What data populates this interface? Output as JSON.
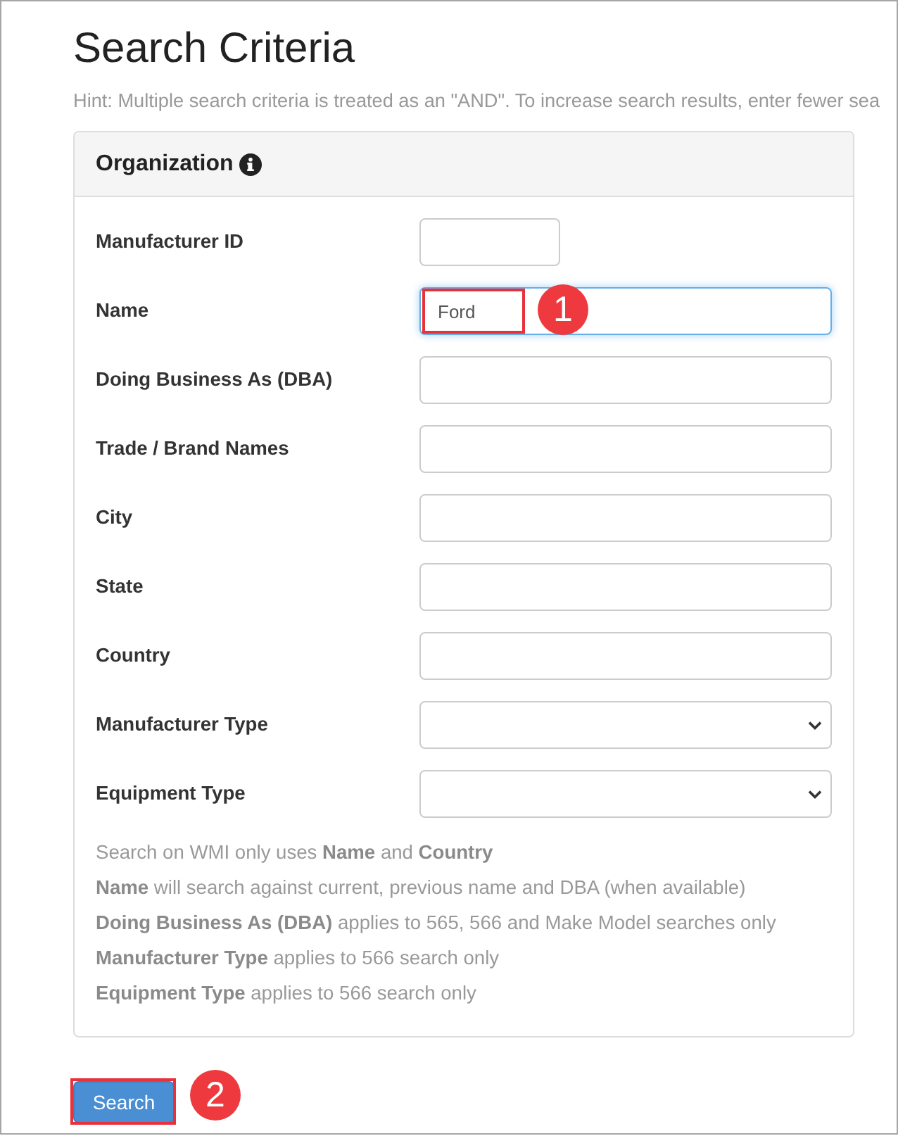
{
  "page": {
    "title": "Search Criteria",
    "hint": "Hint: Multiple search criteria is treated as an \"AND\". To increase search results, enter fewer sea"
  },
  "panel": {
    "title": "Organization",
    "fields": [
      {
        "label": "Manufacturer ID",
        "kind": "short",
        "focused": false
      },
      {
        "label": "Name",
        "kind": "text",
        "value": "Ford",
        "focused": true,
        "callout": "1"
      },
      {
        "label": "Doing Business As (DBA)",
        "kind": "text",
        "focused": false
      },
      {
        "label": "Trade / Brand Names",
        "kind": "text",
        "focused": false
      },
      {
        "label": "City",
        "kind": "text",
        "focused": false
      },
      {
        "label": "State",
        "kind": "text",
        "focused": false
      },
      {
        "label": "Country",
        "kind": "text",
        "focused": false
      },
      {
        "label": "Manufacturer Type",
        "kind": "select",
        "focused": false
      },
      {
        "label": "Equipment Type",
        "kind": "select",
        "focused": false
      }
    ],
    "notes": [
      "Search on WMI only uses **Name** and **Country**",
      "**Name** will search against current, previous name and DBA (when available)",
      "**Doing Business As (DBA)** applies to 565, 566 and Make Model searches only",
      "**Manufacturer Type** applies to 566 search only",
      "**Equipment Type** applies to 566 search only"
    ]
  },
  "search_button": {
    "label": "Search",
    "callout": "2"
  }
}
